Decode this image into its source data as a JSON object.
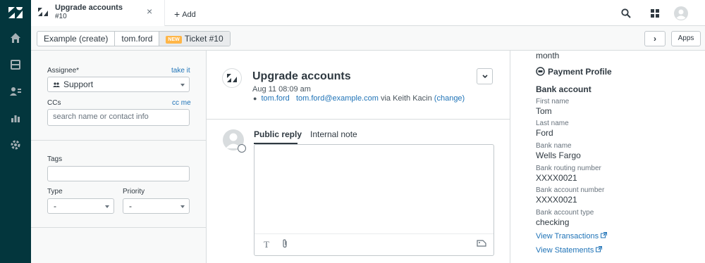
{
  "tab": {
    "title": "Upgrade accounts",
    "subtitle": "#10",
    "close": "×"
  },
  "add_label": "Add",
  "breadcrumbs": {
    "org": "Example (create)",
    "user": "tom.ford",
    "badge": "NEW",
    "ticket": "Ticket #10"
  },
  "subbar": {
    "next": "›",
    "apps": "Apps"
  },
  "properties": {
    "assignee_label": "Assignee*",
    "take_it": "take it",
    "assignee_value": "Support",
    "ccs_label": "CCs",
    "cc_me": "cc me",
    "ccs_placeholder": "search name or contact info",
    "tags_label": "Tags",
    "type_label": "Type",
    "type_value": "-",
    "priority_label": "Priority",
    "priority_value": "-"
  },
  "ticket": {
    "subject": "Upgrade accounts",
    "date": "Aug 11 08:09 am",
    "requester": "tom.ford",
    "email": "tom.ford@example.com",
    "via": "via Keith Kacin",
    "change": "(change)"
  },
  "reply": {
    "public_tab": "Public reply",
    "internal_tab": "Internal note"
  },
  "app_panel": {
    "top_cut": "month",
    "section_title": "Payment Profile",
    "bank_heading": "Bank account",
    "fields": [
      {
        "label": "First name",
        "value": "Tom"
      },
      {
        "label": "Last name",
        "value": "Ford"
      },
      {
        "label": "Bank name",
        "value": "Wells Fargo"
      },
      {
        "label": "Bank routing number",
        "value": "XXXX0021"
      },
      {
        "label": "Bank account number",
        "value": "XXXX0021"
      },
      {
        "label": "Bank account type",
        "value": "checking"
      }
    ],
    "link_transactions": "View Transactions",
    "link_statements": "View Statements"
  },
  "colors": {
    "nav_bg": "#03363d",
    "link": "#1f73b7",
    "badge": "#ffb648"
  }
}
